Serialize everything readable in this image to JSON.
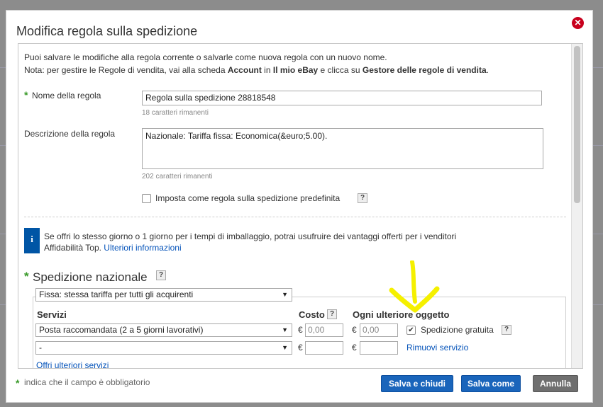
{
  "dialog": {
    "title": "Modifica regola sulla spedizione",
    "close_label": "✕"
  },
  "intro": {
    "line1": "Puoi salvare le modifiche alla regola corrente o salvarle come nuova regola con un nuovo nome.",
    "line2_prefix": "Nota: per gestire le Regole di vendita, vai alla scheda ",
    "line2_account": "Account",
    "line2_in": " in ",
    "line2_myebay": "Il mio eBay",
    "line2_mid": " e clicca su ",
    "line2_manager": "Gestore delle regole di vendita",
    "line2_end": "."
  },
  "form": {
    "required_star": "*",
    "name_label": "Nome della regola",
    "name_value": "Regola sulla spedizione 28818548",
    "name_remaining": "18 caratteri rimanenti",
    "desc_label": "Descrizione della regola",
    "desc_value": "Nazionale: Tariffa fissa: Economica(&euro;5.00).",
    "desc_remaining": "202 caratteri rimanenti",
    "default_checkbox_label": "Imposta come regola sulla spedizione predefinita",
    "help": "?"
  },
  "info": {
    "icon": "i",
    "line1": "Se offri lo stesso giorno o 1 giorno per i tempi di imballaggio, potrai usufruire dei vantaggi offerti per i venditori",
    "line2_prefix": "Affidabilità Top. ",
    "line2_link": "Ulteriori informazioni"
  },
  "domestic": {
    "title": "Spedizione nazionale",
    "type_select": "Fissa: stessa tariffa per tutti gli acquirenti",
    "col_services": "Servizi",
    "col_cost": "Costo",
    "col_additional": "Ogni ulteriore oggetto",
    "currency": "€",
    "rows": [
      {
        "service": "Posta raccomandata (2 a 5 giorni lavorativi)",
        "cost": "0,00",
        "additional": "0,00",
        "free_shipping_label": "Spedizione gratuita",
        "free_shipping_checked": "✔"
      },
      {
        "service": "-",
        "cost": "",
        "additional": "",
        "remove_label": "Rimuovi servizio"
      }
    ],
    "more_services_link": "Offri ulteriori servizi"
  },
  "footer": {
    "required_star": "*",
    "note": "indica che il campo è obbligatorio",
    "save_close": "Salva e chiudi",
    "save_as": "Salva come",
    "cancel": "Annulla"
  },
  "colors": {
    "accent_blue": "#1a65bb",
    "link_blue": "#0654ba",
    "required_green": "#3a9a2a",
    "close_red": "#c8001d",
    "annotation_yellow": "#f5f000"
  },
  "icons": {
    "close": "close-icon",
    "info": "info-icon",
    "dropdown": "chevron-down-icon",
    "annotation": "arrow-down-annotation-icon"
  }
}
